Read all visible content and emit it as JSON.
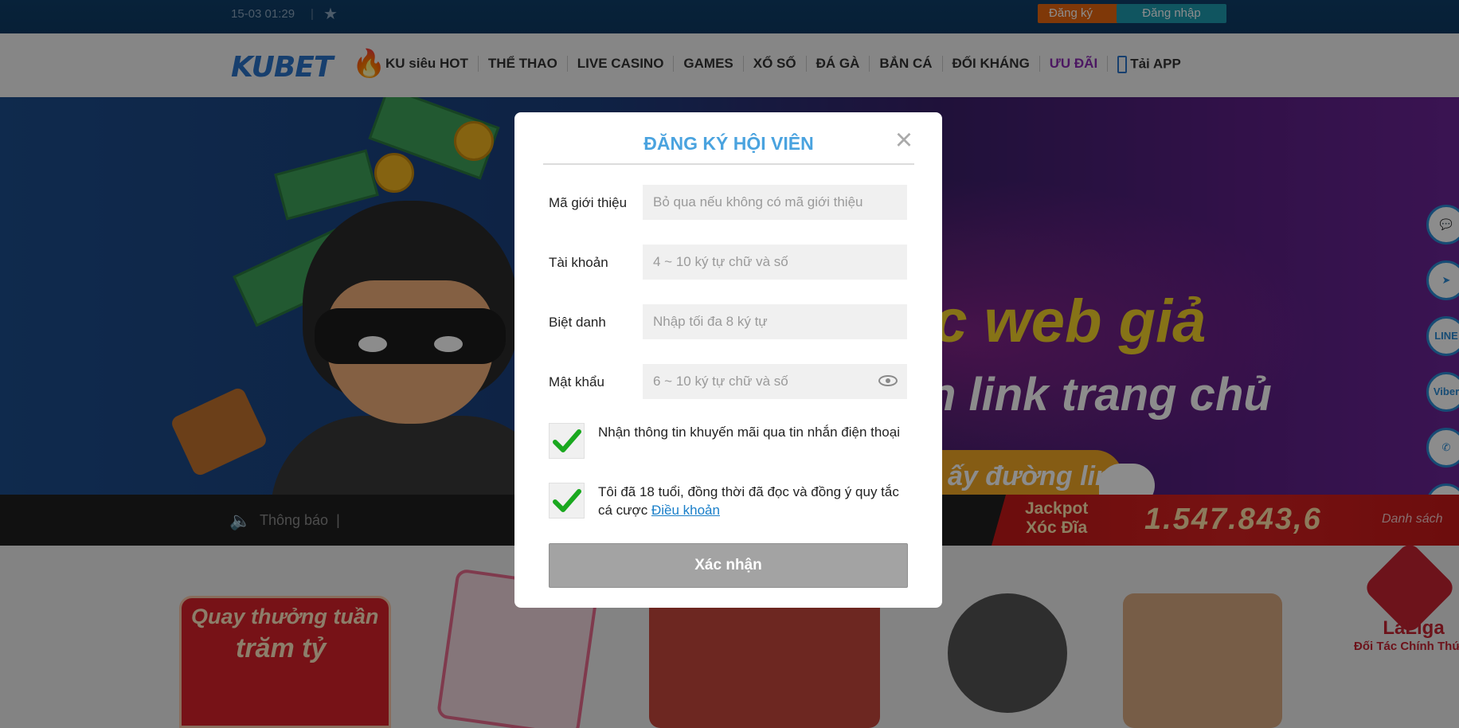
{
  "topbar": {
    "datetime": "15-03 01:29",
    "divider": "|",
    "register_label": "Đăng ký",
    "register_plus": "+",
    "login_label": "Đăng nhập"
  },
  "nav": {
    "logo": {
      "part1": "KU",
      "part2": "BET"
    },
    "items": [
      {
        "label": "KU siêu HOT"
      },
      {
        "label": "THỂ THAO"
      },
      {
        "label": "LIVE CASINO"
      },
      {
        "label": "GAMES"
      },
      {
        "label": "XỔ SỐ"
      },
      {
        "label": "ĐÁ GÀ"
      },
      {
        "label": "BẮN CÁ"
      },
      {
        "label": "ĐỐI KHÁNG"
      },
      {
        "label": "ƯU ĐÃI"
      },
      {
        "label": "Tải APP"
      }
    ]
  },
  "banner": {
    "headline": "ác web giả",
    "subline": "n link trang chủ",
    "button_text": "ấy đường link"
  },
  "side_icons": [
    "chat-icon",
    "telegram-icon",
    "line-icon",
    "viber-icon",
    "phone-icon",
    "image-icon",
    "edit-icon"
  ],
  "side_icon_text": {
    "line": "LINE",
    "viber": "Viber"
  },
  "notice": {
    "label": "Thông báo",
    "divider": "|"
  },
  "jackpot": {
    "title_line1": "Jackpot",
    "title_line2": "Xóc Đĩa",
    "value": "1.547.843,6",
    "list_label": "Danh sách"
  },
  "promos": {
    "card_line1": "Quay thưởng tuần",
    "card_line2": "trăm tỷ",
    "partner_name": "LaLiga",
    "partner_sub": "Đối Tác Chính Thức"
  },
  "modal": {
    "title": "ĐĂNG KÝ HỘI VIÊN",
    "close": "×",
    "fields": [
      {
        "label": "Mã giới thiệu",
        "placeholder": "Bỏ qua nếu không có mã giới thiệu",
        "value": ""
      },
      {
        "label": "Tài khoản",
        "placeholder": "4 ~ 10 ký tự chữ và số",
        "value": ""
      },
      {
        "label": "Biệt danh",
        "placeholder": "Nhập tối đa 8 ký tự",
        "value": ""
      },
      {
        "label": "Mật khẩu",
        "placeholder": "6 ~ 10 ký tự chữ và số",
        "value": ""
      }
    ],
    "checkboxes": [
      {
        "text": "Nhận thông tin khuyến mãi qua tin nhắn điện thoại",
        "checked": true
      },
      {
        "text": "Tôi đã 18 tuổi, đồng thời đã đọc và đồng ý quy tắc cá cược ",
        "link": "Điều khoản",
        "checked": true
      }
    ],
    "submit_label": "Xác nhận"
  },
  "colors": {
    "accent": "#4aa3df",
    "submit_disabled": "#a3a3a3",
    "check_green": "#1aa81f",
    "register_orange": "#e8660f",
    "login_teal": "#1e9bb0"
  }
}
